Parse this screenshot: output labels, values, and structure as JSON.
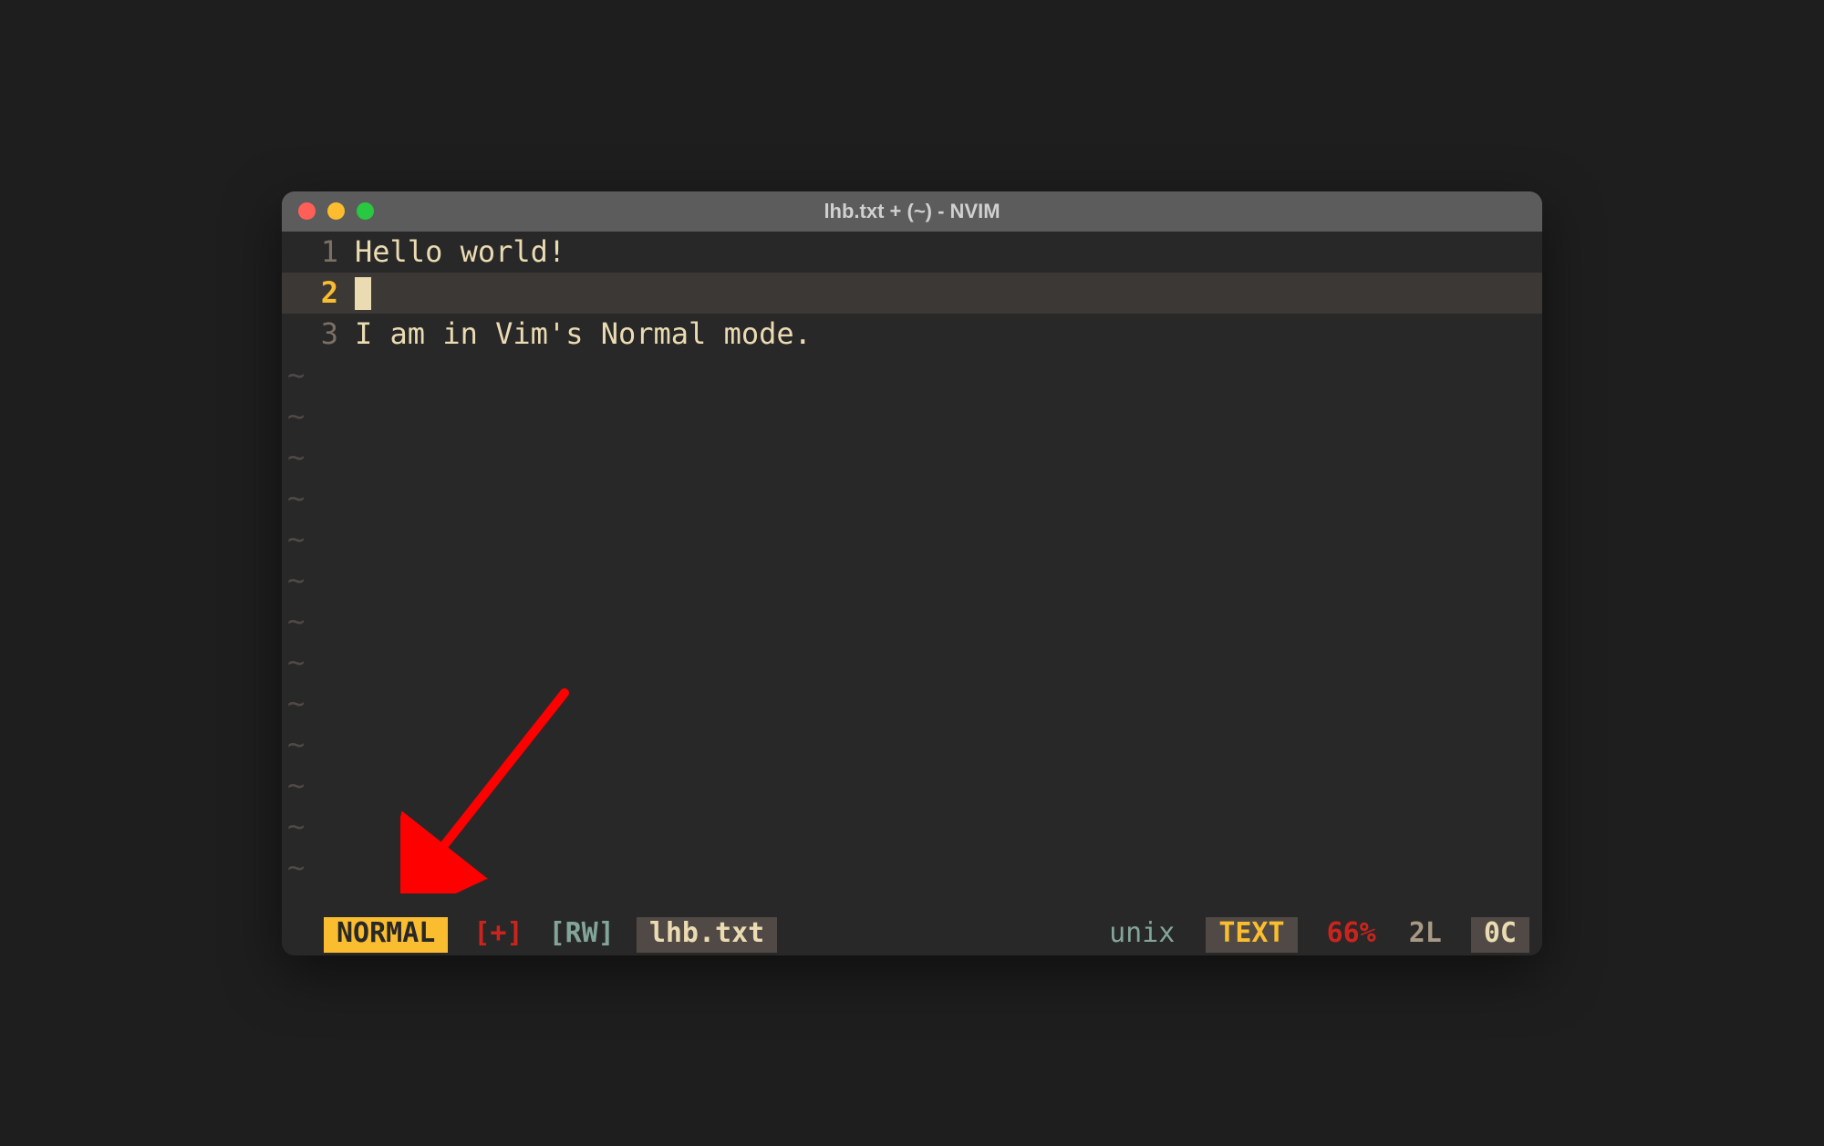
{
  "window": {
    "title": "lhb.txt + (~) - NVIM"
  },
  "editor": {
    "lines": [
      {
        "num": "1",
        "text": "Hello world!"
      },
      {
        "num": "2",
        "text": ""
      },
      {
        "num": "3",
        "text": "I am in Vim's Normal mode."
      }
    ],
    "current_line_index": 1,
    "tilde": "~",
    "tilde_count": 13
  },
  "statusline": {
    "mode": "NORMAL",
    "modified": "[+]",
    "readwrite": "[RW]",
    "filename": "lhb.txt",
    "fileformat": "unix",
    "filetype": "TEXT",
    "percent": "66%",
    "line": "2L",
    "col": "0C"
  },
  "annotation": {
    "arrow_color": "#ff0000"
  }
}
